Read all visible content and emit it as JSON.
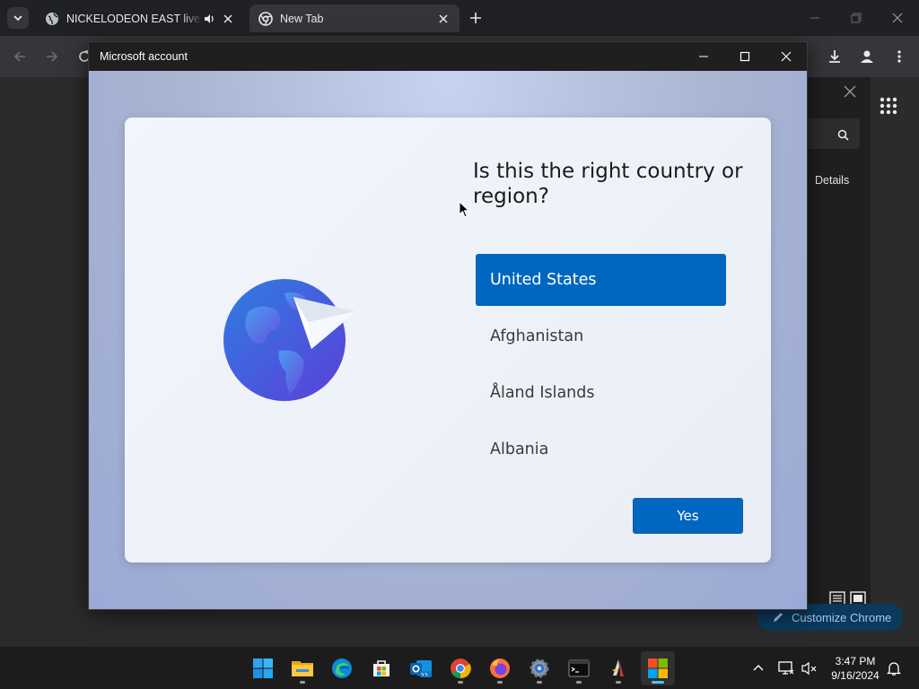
{
  "browser": {
    "tabs": [
      {
        "title": "NICKELODEON EAST live stream",
        "audio": true,
        "active": false
      },
      {
        "title": "New Tab",
        "audio": false,
        "active": true
      }
    ],
    "side_panel": {
      "details_label": "Details"
    },
    "customize_label": "Customize Chrome"
  },
  "dialog": {
    "window_title": "Microsoft account",
    "question": "Is this the right country or region?",
    "countries": [
      {
        "name": "United States",
        "selected": true
      },
      {
        "name": "Afghanistan",
        "selected": false
      },
      {
        "name": "Åland Islands",
        "selected": false
      },
      {
        "name": "Albania",
        "selected": false
      }
    ],
    "confirm_label": "Yes",
    "accent_color": "#0067c0"
  },
  "taskbar": {
    "apps": [
      {
        "name": "start-icon",
        "running": false,
        "active": false
      },
      {
        "name": "file-explorer-icon",
        "running": true,
        "active": false
      },
      {
        "name": "edge-icon",
        "running": false,
        "active": false
      },
      {
        "name": "microsoft-store-icon",
        "running": false,
        "active": false
      },
      {
        "name": "outlook-new-icon",
        "running": false,
        "active": false
      },
      {
        "name": "chrome-icon",
        "running": true,
        "active": false
      },
      {
        "name": "firefox-icon",
        "running": true,
        "active": false
      },
      {
        "name": "settings-icon",
        "running": true,
        "active": false
      },
      {
        "name": "terminal-icon",
        "running": true,
        "active": false
      },
      {
        "name": "app-icon",
        "running": true,
        "active": false
      },
      {
        "name": "microsoft-account-icon",
        "running": true,
        "active": true
      }
    ],
    "time": "3:47 PM",
    "date": "9/16/2024"
  }
}
